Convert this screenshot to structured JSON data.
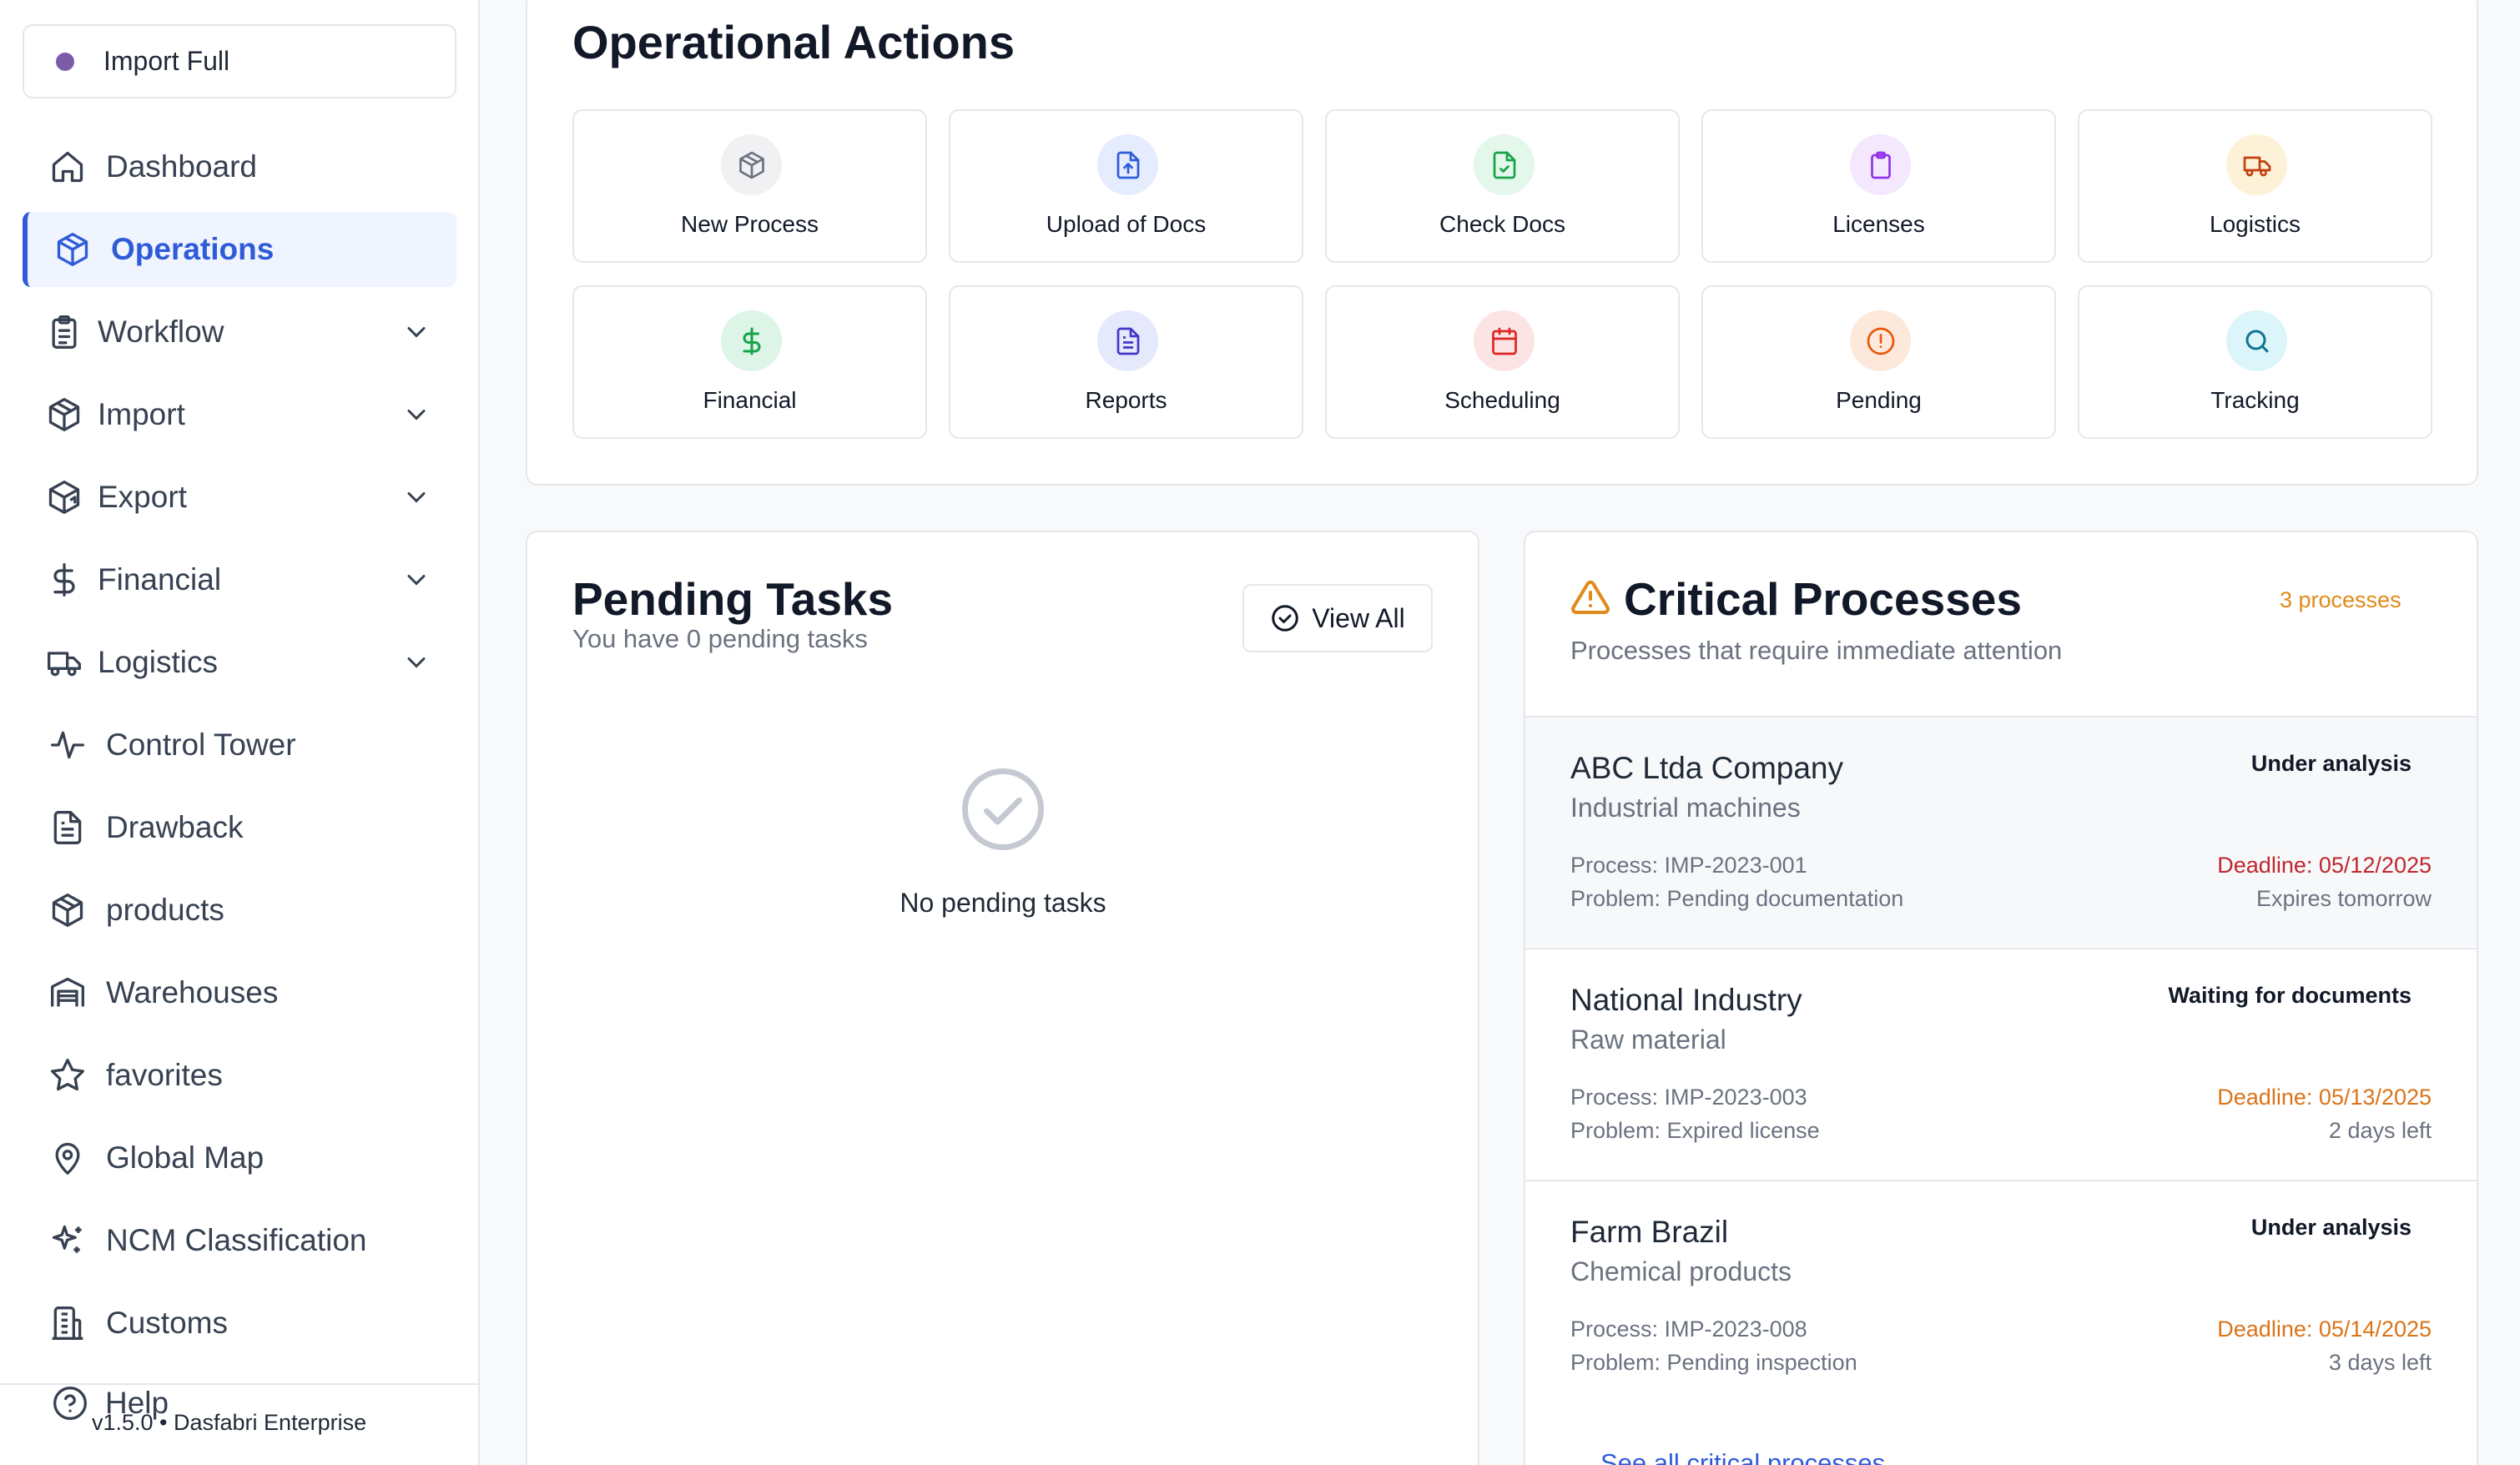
{
  "sidebar": {
    "import_label": "Import Full",
    "items": [
      {
        "label": "Dashboard",
        "icon": "home-icon"
      },
      {
        "label": "Operations",
        "icon": "package-icon"
      },
      {
        "label": "Workflow",
        "icon": "clipboard-icon"
      },
      {
        "label": "Import",
        "icon": "package-icon"
      },
      {
        "label": "Export",
        "icon": "package-export-icon"
      },
      {
        "label": "Financial",
        "icon": "dollar-icon"
      },
      {
        "label": "Logistics",
        "icon": "truck-icon"
      },
      {
        "label": "Control Tower",
        "icon": "activity-icon"
      },
      {
        "label": "Drawback",
        "icon": "file-text-icon"
      },
      {
        "label": "products",
        "icon": "package-icon"
      },
      {
        "label": "Warehouses",
        "icon": "warehouse-icon"
      },
      {
        "label": "favorites",
        "icon": "star-icon"
      },
      {
        "label": "Global Map",
        "icon": "map-pin-icon"
      },
      {
        "label": "NCM Classification",
        "icon": "sparkles-icon"
      },
      {
        "label": "Customs",
        "icon": "building-icon"
      }
    ],
    "help_label": "Help",
    "version": "v1.5.0 • Dasfabri Enterprise"
  },
  "operations": {
    "title": "Operational Actions",
    "actions": [
      {
        "label": "New Process",
        "icon": "package-icon",
        "color": "#6b7280",
        "bg": "#f1f1f4"
      },
      {
        "label": "Upload of Docs",
        "icon": "file-upload-icon",
        "color": "#2f5bd8",
        "bg": "#e5ecfd"
      },
      {
        "label": "Check Docs",
        "icon": "file-check-icon",
        "color": "#16a34a",
        "bg": "#e3f7ea"
      },
      {
        "label": "Licenses",
        "icon": "clipboard-icon",
        "color": "#9333ea",
        "bg": "#f3e8fd"
      },
      {
        "label": "Logistics",
        "icon": "truck-icon",
        "color": "#c2410c",
        "bg": "#fdf1d8"
      },
      {
        "label": "Financial",
        "icon": "dollar-icon",
        "color": "#16a34a",
        "bg": "#dcf5e6"
      },
      {
        "label": "Reports",
        "icon": "file-text-icon",
        "color": "#4338ca",
        "bg": "#e5e9fb"
      },
      {
        "label": "Scheduling",
        "icon": "calendar-icon",
        "color": "#dc2626",
        "bg": "#fde4e4"
      },
      {
        "label": "Pending",
        "icon": "alert-circle-icon",
        "color": "#ea580c",
        "bg": "#fde9dc"
      },
      {
        "label": "Tracking",
        "icon": "search-icon",
        "color": "#0e7490",
        "bg": "#dcf5fa"
      }
    ]
  },
  "pending": {
    "title": "Pending Tasks",
    "subtitle": "You have 0 pending tasks",
    "view_all": "View All",
    "empty_text": "No pending tasks"
  },
  "critical": {
    "title": "Critical Processes",
    "count": "3 processes",
    "subtitle": "Processes that require immediate attention",
    "processes": [
      {
        "company": "ABC Ltda Company",
        "product": "Industrial machines",
        "status": "Under analysis",
        "process": "Process: IMP-2023-001",
        "problem": "Problem: Pending documentation",
        "deadline": "Deadline: 05/12/2025",
        "left": "Expires tomorrow",
        "deadline_color": "#c0262d"
      },
      {
        "company": "National Industry",
        "product": "Raw material",
        "status": "Waiting for documents",
        "process": "Process: IMP-2023-003",
        "problem": "Problem: Expired license",
        "deadline": "Deadline: 05/13/2025",
        "left": "2 days left",
        "deadline_color": "#d9741a"
      },
      {
        "company": "Farm Brazil",
        "product": "Chemical products",
        "status": "Under analysis",
        "process": "Process: IMP-2023-008",
        "problem": "Problem: Pending inspection",
        "deadline": "Deadline: 05/14/2025",
        "left": "3 days left",
        "deadline_color": "#d9741a"
      }
    ],
    "see_all": "See all critical processes"
  }
}
